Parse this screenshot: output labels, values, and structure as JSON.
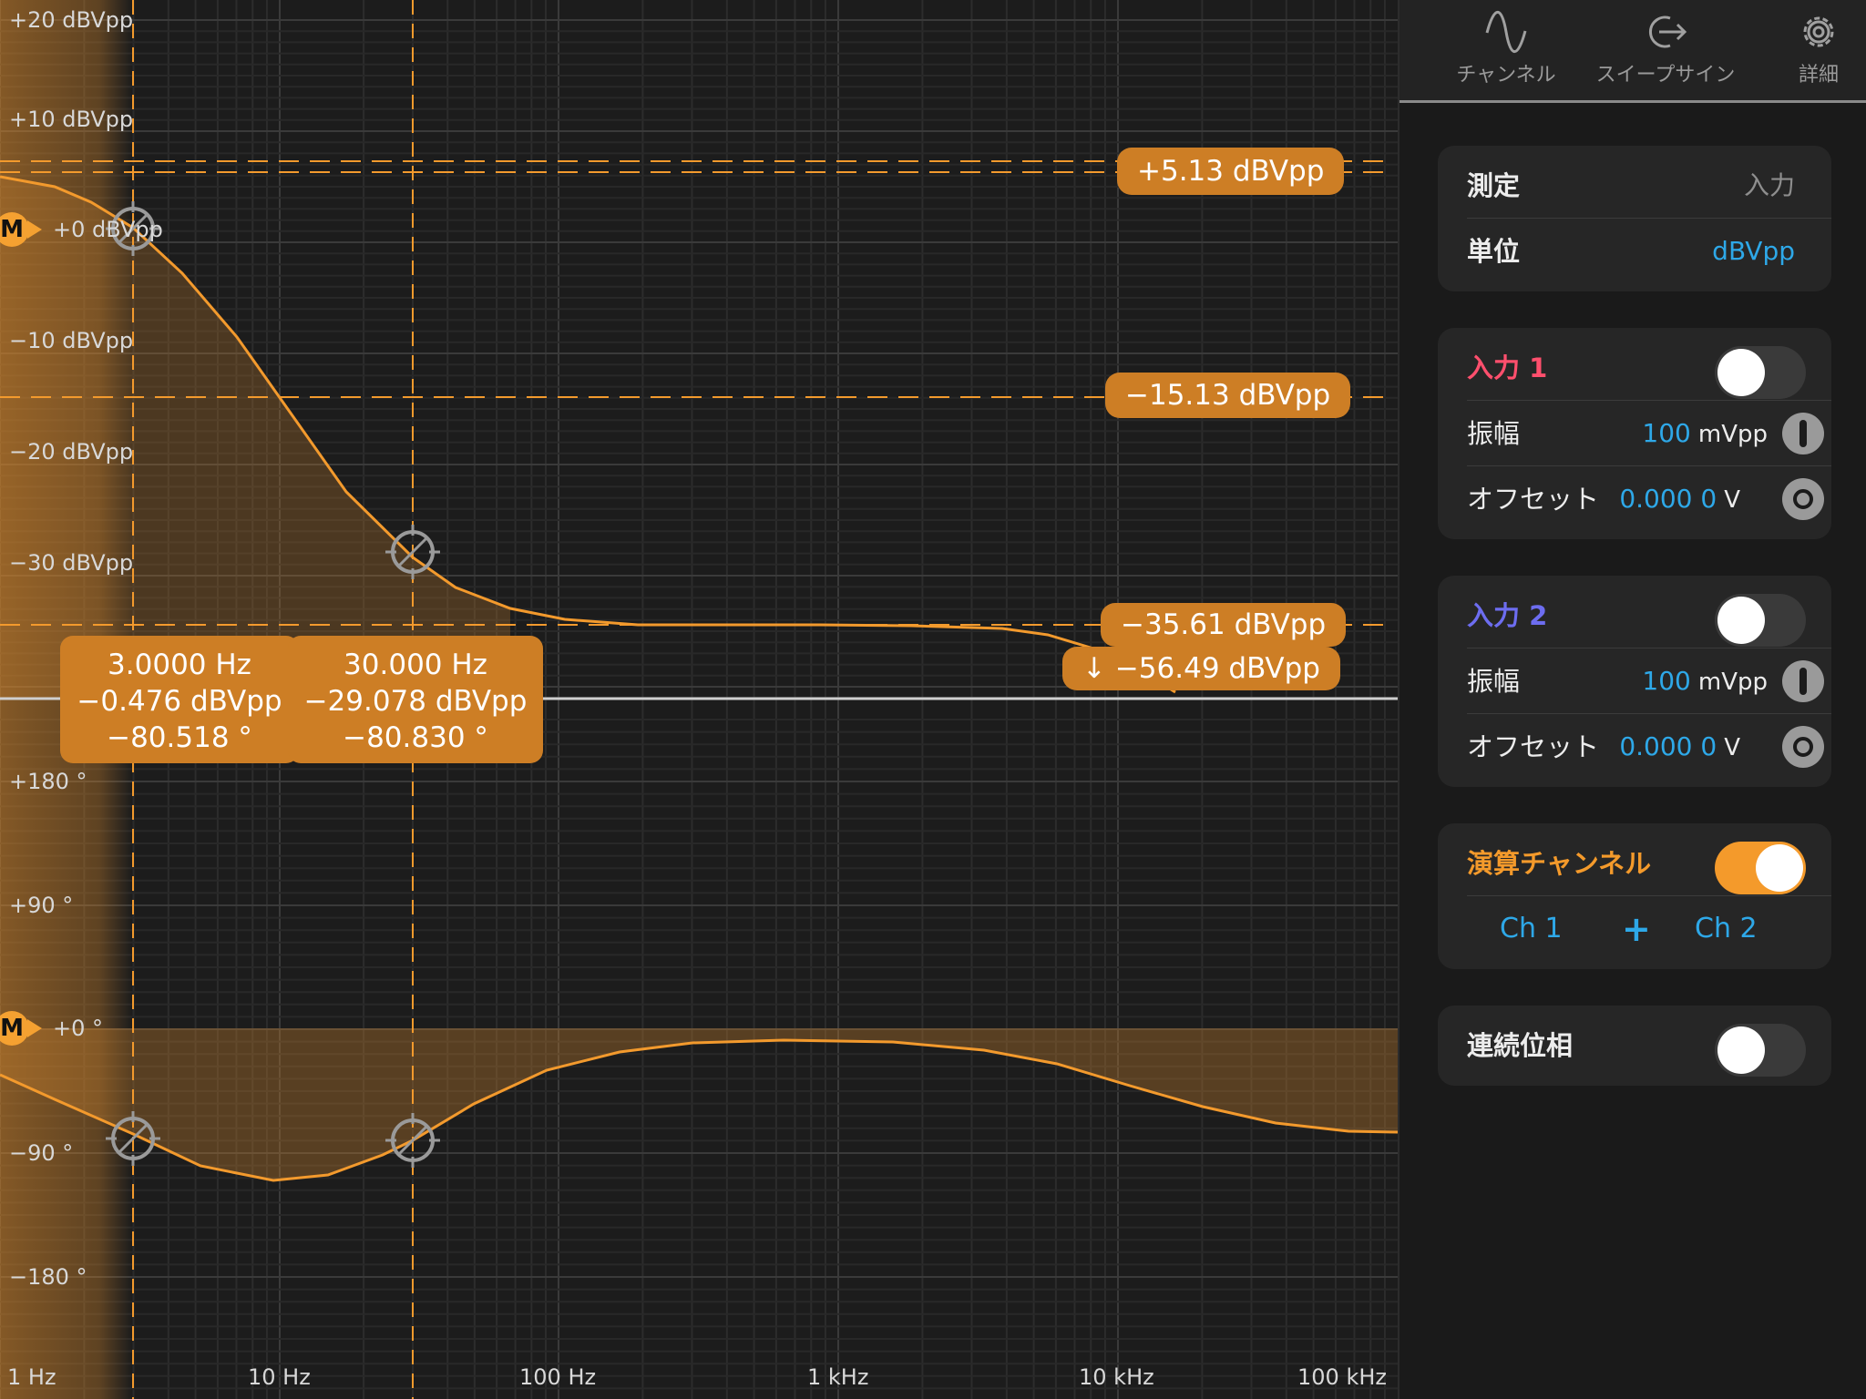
{
  "plot": {
    "magnitude_labels": [
      "+20 dBVpp",
      "+10 dBVpp",
      "+0 dBVpp",
      "−10 dBVpp",
      "−20 dBVpp",
      "−30 dBVpp"
    ],
    "phase_labels": [
      "+180 °",
      "+90 °",
      "+0 °",
      "−90 °",
      "−180 °"
    ],
    "freq_labels": [
      "1 Hz",
      "10 Hz",
      "100 Hz",
      "1 kHz",
      "10 kHz",
      "100 kHz"
    ],
    "marker_symbol": "M",
    "marker_magnitude_label": "+0 dBVpp",
    "marker_phase_label": "+0 °",
    "level_badges": [
      "+5.13 dBVpp",
      "−15.13 dBVpp",
      "−35.61 dBVpp",
      "↓ −56.49 dBVpp"
    ],
    "cursor1": {
      "freq": "3.0000 Hz",
      "mag": "−0.476 dBVpp",
      "phase": "−80.518 °"
    },
    "cursor2": {
      "freq": "30.000 Hz",
      "mag": "−29.078 dBVpp",
      "phase": "−80.830 °"
    },
    "trace_color": "#f39a2d",
    "badge_color": "#cd7e25"
  },
  "tabs": [
    {
      "label": "チャンネル",
      "icon": "sine-wave-icon"
    },
    {
      "label": "スイープサイン",
      "icon": "sweep-output-icon"
    },
    {
      "label": "詳細",
      "icon": "gear-icon"
    }
  ],
  "settings": {
    "measure_label": "測定",
    "measure_value": "入力",
    "unit_label": "単位",
    "unit_value": "dBVpp"
  },
  "input1": {
    "title": "入力 1",
    "title_color": "#ff4f6d",
    "enabled": false,
    "amp_label": "振幅",
    "amp_value": "100",
    "amp_unit": "mVpp",
    "offset_label": "オフセット",
    "offset_value": "0.000 0",
    "offset_unit": "V"
  },
  "input2": {
    "title": "入力 2",
    "title_color": "#6d6df0",
    "enabled": false,
    "amp_label": "振幅",
    "amp_value": "100",
    "amp_unit": "mVpp",
    "offset_label": "オフセット",
    "offset_value": "0.000 0",
    "offset_unit": "V"
  },
  "math": {
    "title": "演算チャンネル",
    "title_color": "#f49a2b",
    "enabled": true,
    "operand1": "Ch 1",
    "operator": "+",
    "operand2": "Ch 2"
  },
  "continuous_phase": {
    "label": "連続位相",
    "enabled": false
  }
}
